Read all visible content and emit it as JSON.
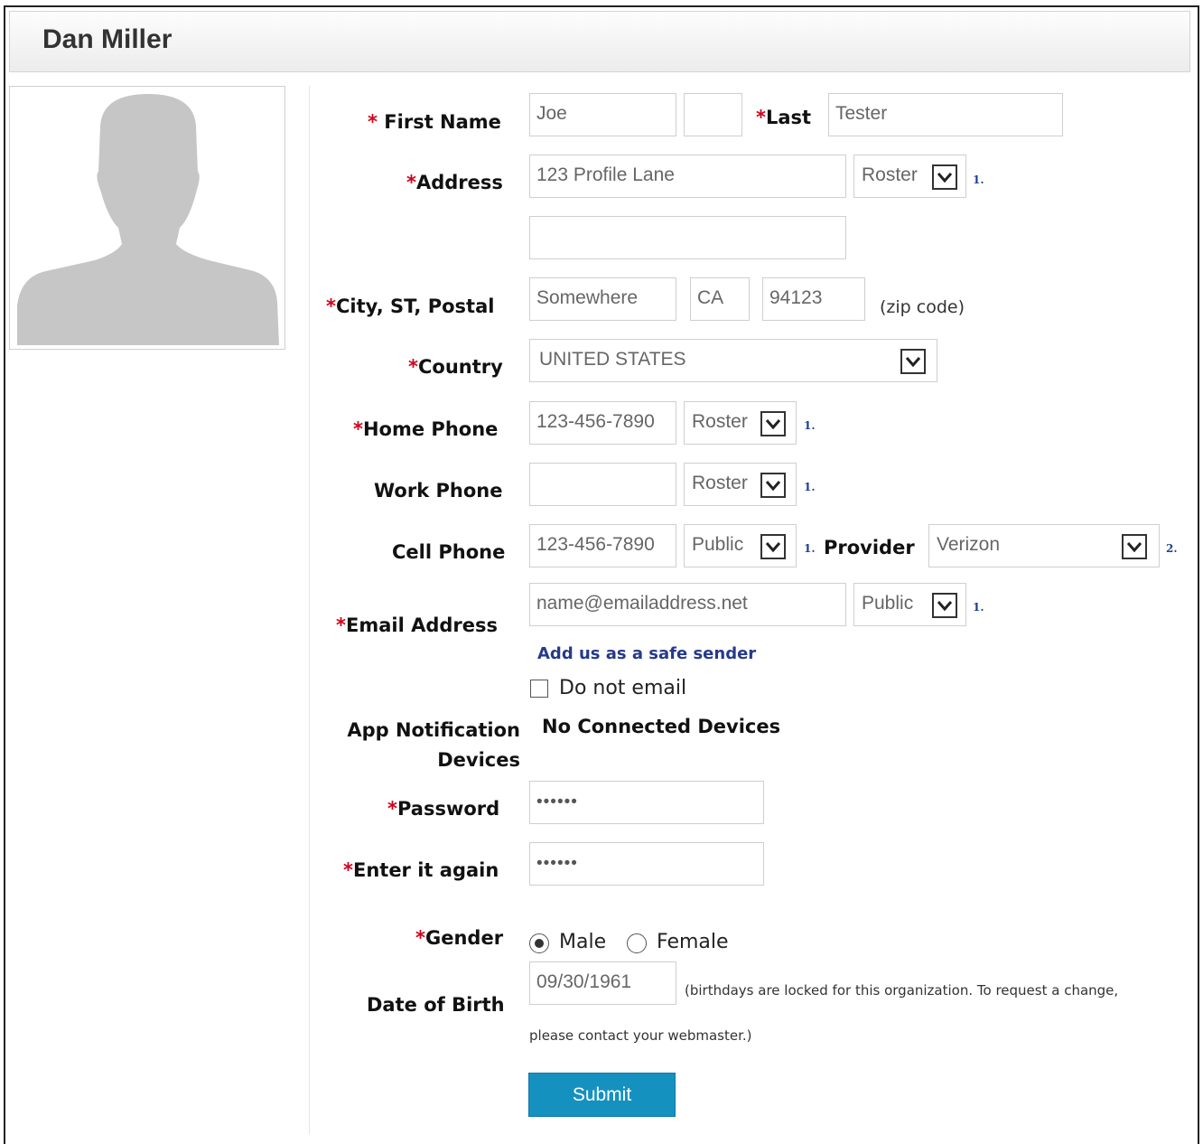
{
  "header": {
    "title": "Dan Miller"
  },
  "profile": {
    "photo_icon": "avatar-silhouette-icon"
  },
  "form": {
    "first_name": {
      "label": "First Name",
      "value": "Joe",
      "middle_value": ""
    },
    "last_name": {
      "label": "Last",
      "value": "Tester"
    },
    "address": {
      "label": "Address",
      "line1": "123 Profile Lane",
      "line2": "",
      "visibility": "Roster",
      "ref": "1."
    },
    "city_st_postal": {
      "label": "City, ST, Postal",
      "city": "Somewhere",
      "state": "CA",
      "postal": "94123",
      "hint": "(zip code)"
    },
    "country": {
      "label": "Country",
      "value": "UNITED STATES"
    },
    "home_phone": {
      "label": "Home Phone",
      "value": "123-456-7890",
      "visibility": "Roster",
      "ref": "1."
    },
    "work_phone": {
      "label": "Work Phone",
      "value": "",
      "visibility": "Roster",
      "ref": "1."
    },
    "cell_phone": {
      "label": "Cell Phone",
      "value": "123-456-7890",
      "visibility": "Public",
      "ref": "1."
    },
    "provider": {
      "label": "Provider",
      "value": "Verizon",
      "ref": "2."
    },
    "email": {
      "label": "Email Address",
      "value": "name@emailaddress.net",
      "visibility": "Public",
      "ref": "1.",
      "safe_sender_link": "Add us as a safe sender",
      "do_not_email": "Do not email"
    },
    "app_notification": {
      "label_line1": "App Notification",
      "label_line2": "Devices",
      "value": "No Connected Devices"
    },
    "password": {
      "label": "Password",
      "value": "••••••"
    },
    "password_again": {
      "label": "Enter it again",
      "value": "••••••"
    },
    "gender": {
      "label": "Gender",
      "male": "Male",
      "female": "Female",
      "selected": "Male"
    },
    "dob": {
      "label": "Date of Birth",
      "value": "09/30/1961",
      "note_line1": "(birthdays are locked for this organization. To request a change,",
      "note_line2": "please contact your webmaster.)"
    },
    "required_marker": "*",
    "submit_label": "Submit"
  }
}
